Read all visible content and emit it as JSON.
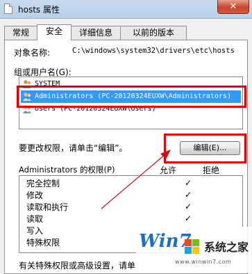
{
  "window": {
    "title": "hosts 属性",
    "close_label": "✕"
  },
  "tabs": [
    {
      "label": "常规",
      "active": false
    },
    {
      "label": "安全",
      "active": true
    },
    {
      "label": "详细信息",
      "active": false
    },
    {
      "label": "以前的版本",
      "active": false
    }
  ],
  "object_name": {
    "label": "对象名称:",
    "value": "C:\\windows\\system32\\drivers\\etc\\hosts"
  },
  "groups": {
    "label": "组或用户名(G):",
    "items": [
      {
        "text": "SYSTEM",
        "selected": false
      },
      {
        "text": "Administrators (PC-20120324EUXW\\Administrators)",
        "selected": true
      },
      {
        "text": "Users (PC-20120324EUXW\\Users)",
        "selected": false
      }
    ]
  },
  "edit_hint": "要更改权限，请单击“编辑”。",
  "edit_button": "编辑(E)...",
  "permissions": {
    "title": "Administrators 的权限(P)",
    "allow_header": "允许",
    "deny_header": "拒绝",
    "rows": [
      {
        "name": "完全控制",
        "allow": "✓",
        "deny": ""
      },
      {
        "name": "修改",
        "allow": "✓",
        "deny": ""
      },
      {
        "name": "读取和执行",
        "allow": "✓",
        "deny": ""
      },
      {
        "name": "读取",
        "allow": "✓",
        "deny": ""
      },
      {
        "name": "写入",
        "allow": "✓",
        "deny": ""
      },
      {
        "name": "特殊权限",
        "allow": "",
        "deny": ""
      }
    ]
  },
  "bottom_text": "有关特殊权限或高级设置，请单",
  "watermark": {
    "logo": "Win7",
    "text": "系统之家",
    "url": "www.winwin7.com"
  },
  "colors": {
    "highlight_red": "#e20000",
    "selection_blue": "#3399ff"
  }
}
